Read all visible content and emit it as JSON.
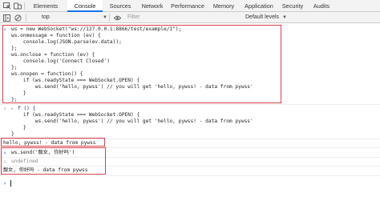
{
  "tabs": {
    "elements": "Elements",
    "console": "Console",
    "sources": "Sources",
    "network": "Network",
    "performance": "Performance",
    "memory": "Memory",
    "application": "Application",
    "security": "Security",
    "audits": "Audits"
  },
  "toolbar": {
    "context": "top",
    "filter_placeholder": "Filter",
    "levels": "Default levels"
  },
  "console": {
    "input_lines": [
      "ws = new WebSocket(\"ws://127.0.0.1:8866/test/example/1\");",
      "ws.onmessage = function (ev) {",
      "    console.log(JSON.parse(ev.data));",
      "};",
      "ws.onclose = function (ev) {",
      "    console.log('Connect Closed')",
      "};",
      "ws.onopen = function() {",
      "    if (ws.readyState === WebSocket.OPEN) {",
      "        ws.send('hello, pywss') // you will get 'hello, pywss! - data from pywss'",
      "    }",
      "};"
    ],
    "result_head": "f () {",
    "result_lines": [
      "    if (ws.readyState === WebSocket.OPEN) {",
      "        ws.send('hello, pywss') // you will get 'hello, pywss! - data from pywss'",
      "    }",
      "}"
    ],
    "log_1": "hello, pywss! - data from pywss",
    "input_2": "ws.send('靓女, 你好吗')",
    "undefined": "undefined",
    "log_2": "靓女, 你好吗 - data from pywss"
  },
  "colors": {
    "highlight_box": "#d9404a",
    "active_tab_underline": "#1a73e8",
    "prompt": "#1a73e8"
  }
}
